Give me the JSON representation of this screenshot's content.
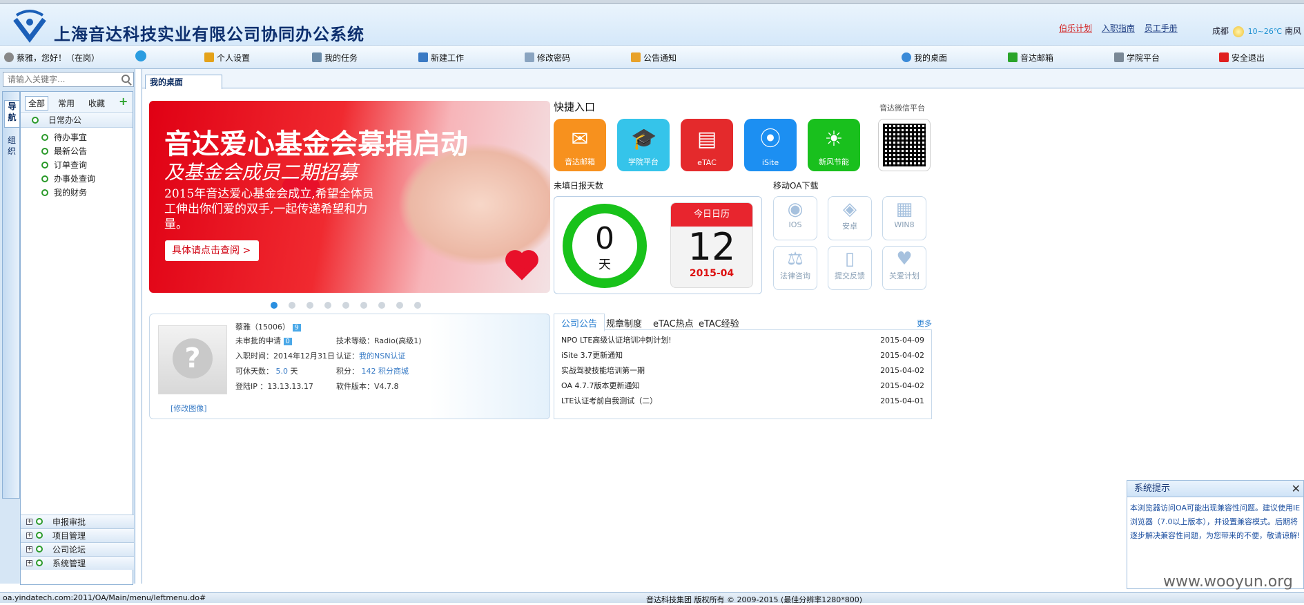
{
  "header": {
    "title": "上海音达科技实业有限公司协同办公系统",
    "links": [
      "伯乐计划",
      "入职指南",
      "员工手册"
    ],
    "weather_city": "成都",
    "weather_temp": "10~26℃",
    "weather_trail": "南风"
  },
  "toolbar": {
    "user": "蔡雅，您好！（在岗）",
    "left_items": [
      "个人设置",
      "我的任务",
      "新建工作",
      "修改密码",
      "公告通知"
    ],
    "right_items": [
      "我的桌面",
      "音达邮箱",
      "学院平台",
      "安全退出"
    ]
  },
  "sidebar": {
    "search_placeholder": "请输入关键字...",
    "vtabs": [
      "导航",
      "组织"
    ],
    "filters": [
      "全部",
      "常用",
      "收藏"
    ],
    "group": "日常办公",
    "items": [
      "待办事宜",
      "最新公告",
      "订单查询",
      "办事处查询",
      "我的财务"
    ],
    "bottom_groups": [
      "申报审批",
      "项目管理",
      "公司论坛",
      "系统管理"
    ]
  },
  "main": {
    "tab": "我的桌面",
    "banner": {
      "line1": "音达爱心基金会募捐启动",
      "line2": "及基金会成员二期招募",
      "line3": "2015年音达爱心基金会成立,希望全体员工伸出你们爱的双手,一起传递希望和力量。",
      "button": "具体请点击查阅 >"
    },
    "quick": {
      "title": "快捷入口",
      "wechat_label": "音达微信平台",
      "tiles": [
        {
          "label": "音达邮箱",
          "color": "#f7911e",
          "icon": "mail-icon"
        },
        {
          "label": "学院平台",
          "color": "#35c4ea",
          "icon": "graduation-cap-icon"
        },
        {
          "label": "eTAC",
          "color": "#e42a2c",
          "icon": "calendar-list-icon"
        },
        {
          "label": "iSite",
          "color": "#1c8ff2",
          "icon": "location-pin-icon"
        },
        {
          "label": "新风节能",
          "color": "#19c01d",
          "icon": "bulb-icon"
        }
      ]
    },
    "daily": {
      "label": "未填日报天数",
      "count": "0",
      "unit": "天",
      "cal_title": "今日日历",
      "cal_day": "12",
      "cal_ym": "2015-04"
    },
    "mobile": {
      "label": "移动OA下载",
      "tiles": [
        "IOS",
        "安卓",
        "WIN8",
        "法律咨询",
        "提交反馈",
        "关爱计划"
      ]
    },
    "profile": {
      "edit": "[修改图像]",
      "name": "蔡雅（15006）",
      "msg_count": "9",
      "pending_label": "未审批的申请",
      "pending_count": "0",
      "join_date": "入职时间：2014年12月31日",
      "leave_label": "可休天数：",
      "leave_value": "5.0",
      "leave_unit": "天",
      "ip": "登陆IP ：13.13.13.17",
      "tech_level": "技术等级：Radio(高级1)",
      "cert_label": "认证：",
      "cert_value": "我的NSN认证",
      "points_label": "积分：",
      "points_value": "142 积分商城",
      "version": "软件版本：V4.7.8"
    },
    "notice": {
      "tabs": [
        "公司公告",
        "规章制度",
        "eTAC热点",
        "eTAC经验"
      ],
      "more": "更多",
      "rows": [
        {
          "title": "NPO LTE高级认证培训冲刺计划!",
          "date": "2015-04-09"
        },
        {
          "title": "iSite 3.7更新通知",
          "date": "2015-04-02"
        },
        {
          "title": "实战驾驶技能培训第一期",
          "date": "2015-04-02"
        },
        {
          "title": "OA 4.7.7版本更新通知",
          "date": "2015-04-02"
        },
        {
          "title": "LTE认证考前自我测试（二）",
          "date": "2015-04-01"
        }
      ]
    }
  },
  "popup": {
    "title": "系统提示",
    "body": "本浏览器访问OA可能出现兼容性问题。建议使用IE浏览器（7.0以上版本），并设置兼容模式。后期将逐步解决兼容性问题，为您带来的不便，敬请谅解!"
  },
  "status": {
    "url": "oa.yindatech.com:2011/OA/Main/menu/leftmenu.do#",
    "footer": "音达科技集团 版权所有 © 2009-2015 (最佳分辨率1280*800)"
  },
  "watermark": "www.wooyun.org"
}
